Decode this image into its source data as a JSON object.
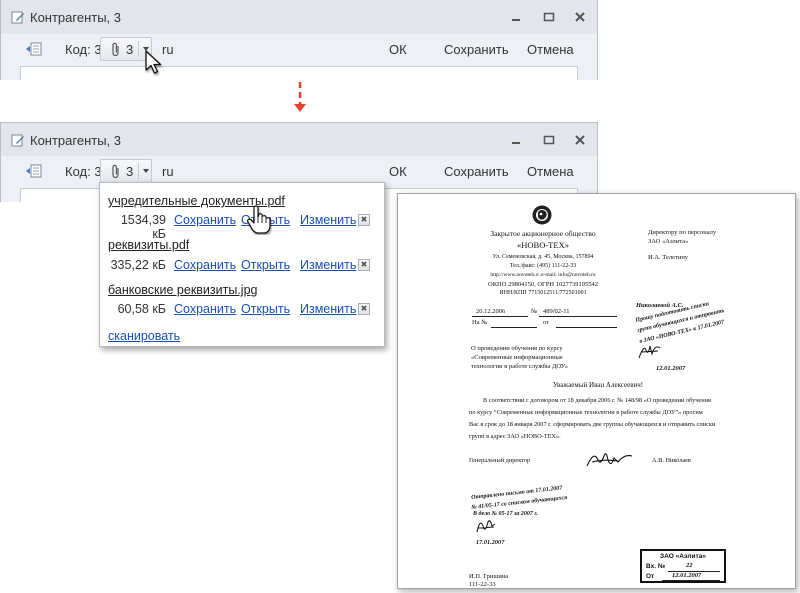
{
  "window": {
    "title": "Контрагенты, 3",
    "code_label": "Код: 3",
    "attach_count": "3",
    "lang": "ru",
    "ok_label": "ОК",
    "save_label": "Сохранить",
    "cancel_label": "Отмена"
  },
  "attachments": {
    "files": [
      {
        "name": "учредительные документы.pdf",
        "size": "1534,39 кБ",
        "save": "Сохранить",
        "open": "Открыть",
        "edit": "Изменить"
      },
      {
        "name": "реквизиты.pdf",
        "size": "335,22 кБ",
        "save": "Сохранить",
        "open": "Открыть",
        "edit": "Изменить"
      },
      {
        "name": "банковские реквизиты.jpg",
        "size": "60,58 кБ",
        "save": "Сохранить",
        "open": "Открыть",
        "edit": "Изменить"
      }
    ],
    "scan_label": "сканировать"
  },
  "colors": {
    "accent_arrow": "#e8412c",
    "link": "#1a4fb5"
  },
  "document": {
    "company_type": "Закрытое акционерное общество",
    "company_name": "«НОВО-ТЕХ»",
    "address": "Ул. Семеновская, д. 45, Москва, 157894",
    "phone": "Тел./факс: (495) 111-22-33",
    "web": "http://www.novoteh.rc.e-mail: info@novoteh.ru",
    "okpo": "ОКПО 29804150, ОГРН 1027739195542",
    "inn": "ИНН/КПП 7715012511/772501001",
    "date": "20.12.2006",
    "num_prefix": "№",
    "number": "489/02-11",
    "na_label": "На №",
    "ot_label": "от",
    "subject_1": "О проведении обучения по курсу",
    "subject_2": "«Современные информационные",
    "subject_3": "технологии в работе службы ДОУ»",
    "to_1": "Директору по персоналу",
    "to_2": "ЗАО «Аэлита»",
    "to_3": "И.А. Телетину",
    "res_name": "Николаевой А.С.",
    "res_1": "Прошу подготовить списки",
    "res_2": "групп обучающихся и отправить",
    "res_3": "в ЗАО «НОВО-ТЕХ» к 17.01.2007",
    "res_date": "12.01.2007",
    "greeting": "Уважаемый Иван Алексеевич!",
    "body_1": "В соответствии с договором от 18 декабря 2006 г. № 148/98 «О проведении обучения",
    "body_2": "по курсу “Современные информационные технологии в работе службы ДОУ”» просим",
    "body_3": "Вас в срок до 18 января 2007 г. сформировать две группы обучающихся и отправить списки",
    "body_4": "групп в адрес ЗАО «НОВО-ТЕХ».",
    "sign_role": "Генеральный директор",
    "sign_name": "А.В. Николаев",
    "note_1": "Отправлено письмо от 17.01.2007",
    "note_2": "№ 41/05-17 со списком обучающихся",
    "note_3": "В дело № 05-17 за 2007 г.",
    "note_date": "17.01.2007",
    "exec_name": "И.П. Гришина",
    "exec_phone": "111-22-33",
    "stamp_title": "ЗАО «Аэлита»",
    "stamp_in_label": "Вх. №",
    "stamp_in_num": "22",
    "stamp_from_label": "От",
    "stamp_from_date": "12.01.2007"
  }
}
